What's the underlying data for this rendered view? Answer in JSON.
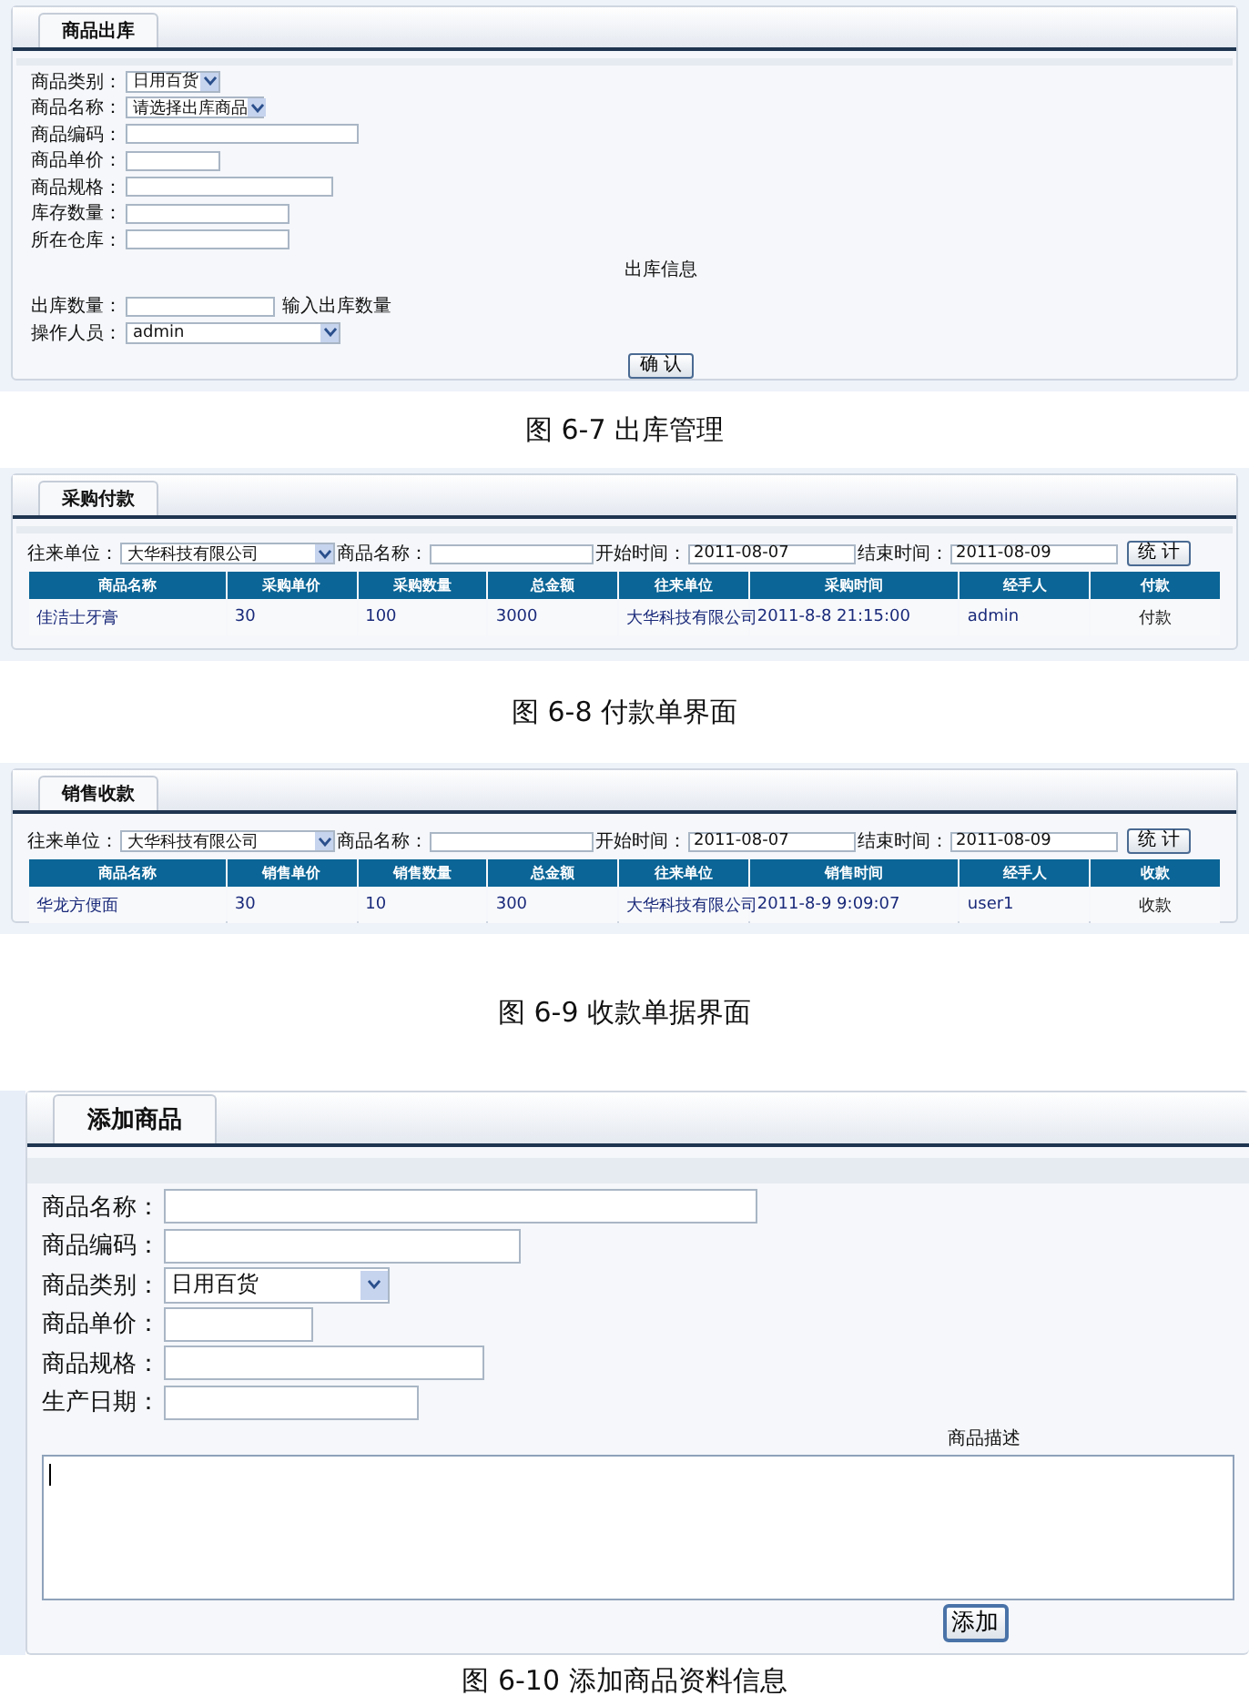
{
  "stock_out": {
    "tab": "商品出库",
    "fields": [
      {
        "label": "商品类别：",
        "kind": "select",
        "value": "日用百货"
      },
      {
        "label": "商品名称：",
        "kind": "select",
        "value": "请选择出库商品"
      },
      {
        "label": "商品编码：",
        "kind": "input"
      },
      {
        "label": "商品单价：",
        "kind": "input"
      },
      {
        "label": "商品规格：",
        "kind": "input"
      },
      {
        "label": "库存数量：",
        "kind": "input"
      },
      {
        "label": "所在仓库：",
        "kind": "input"
      }
    ],
    "section_label": "出库信息",
    "out_fields": [
      {
        "label": "出库数量：",
        "kind": "input",
        "hint": "输入出库数量"
      },
      {
        "label": "操作人员：",
        "kind": "select",
        "value": "admin"
      }
    ],
    "button": "确 认",
    "caption": "图 6-7  出库管理"
  },
  "payment": {
    "tab": "采购付款",
    "filters": [
      {
        "label": "往来单位：",
        "kind": "select",
        "value": "大华科技有限公司"
      },
      {
        "label": "商品名称：",
        "kind": "input"
      },
      {
        "label": "开始时间：",
        "kind": "input",
        "value": "2011-08-07"
      },
      {
        "label": "结束时间：",
        "kind": "input",
        "value": "2011-08-09"
      }
    ],
    "button": "统 计",
    "columns": [
      "商品名称",
      "采购单价",
      "采购数量",
      "总金额",
      "往来单位",
      "采购时间",
      "经手人",
      "付款"
    ],
    "rows": [
      [
        "佳洁士牙膏",
        "30",
        "100",
        "3000",
        "大华科技有限公司",
        "2011-8-8 21:15:00",
        "admin",
        "付款"
      ]
    ],
    "caption": "图 6-8  付款单界面"
  },
  "receipt": {
    "tab": "销售收款",
    "filters": [
      {
        "label": "往来单位：",
        "kind": "select",
        "value": "大华科技有限公司"
      },
      {
        "label": "商品名称：",
        "kind": "input"
      },
      {
        "label": "开始时间：",
        "kind": "input",
        "value": "2011-08-07"
      },
      {
        "label": "结束时间：",
        "kind": "input",
        "value": "2011-08-09"
      }
    ],
    "button": "统 计",
    "columns": [
      "商品名称",
      "销售单价",
      "销售数量",
      "总金额",
      "往来单位",
      "销售时间",
      "经手人",
      "收款"
    ],
    "rows": [
      [
        "华龙方便面",
        "30",
        "10",
        "300",
        "大华科技有限公司",
        "2011-8-9 9:09:07",
        "user1",
        "收款"
      ]
    ],
    "caption": "图 6-9  收款单据界面"
  },
  "add_product": {
    "tab": "添加商品",
    "fields": [
      {
        "label": "商品名称：",
        "kind": "input"
      },
      {
        "label": "商品编码：",
        "kind": "input"
      },
      {
        "label": "商品类别：",
        "kind": "select",
        "value": "日用百货"
      },
      {
        "label": "商品单价：",
        "kind": "input"
      },
      {
        "label": "商品规格：",
        "kind": "input"
      },
      {
        "label": "生产日期：",
        "kind": "input"
      }
    ],
    "description_label": "商品描述",
    "button": "添加",
    "caption": "图 6-10  添加商品资料信息"
  }
}
